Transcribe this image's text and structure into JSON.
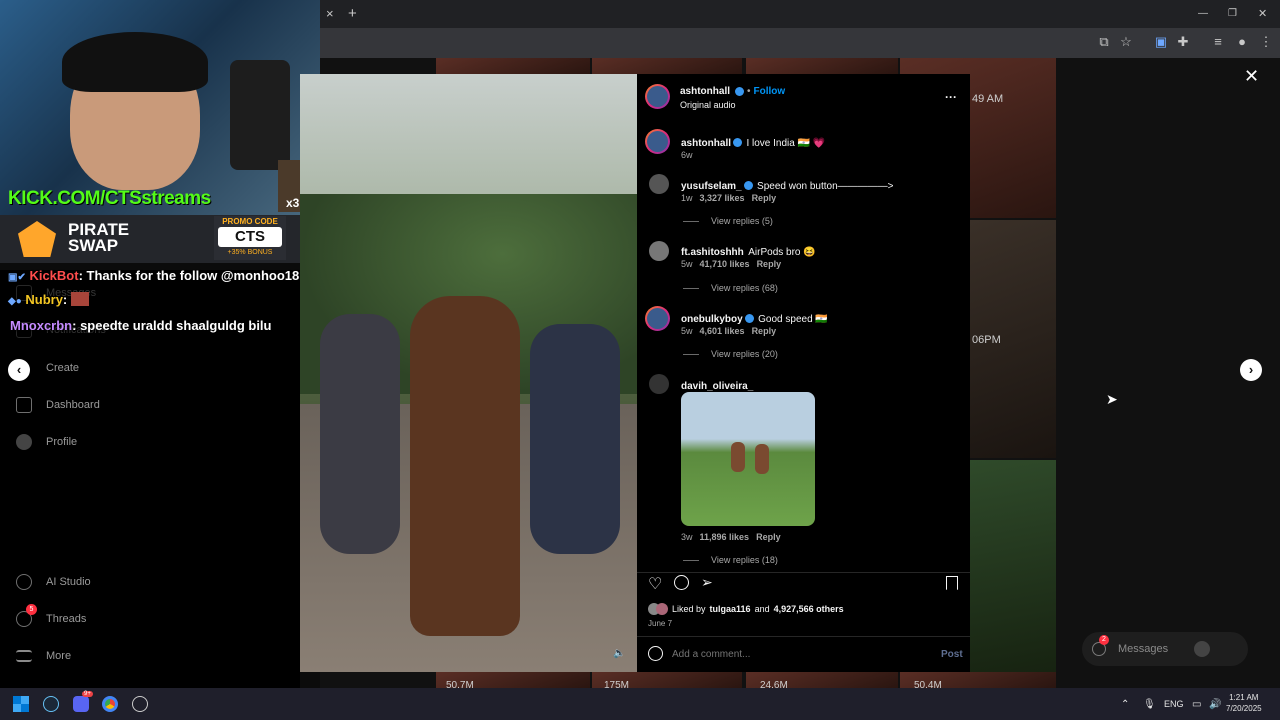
{
  "browser": {
    "close_tab": "×",
    "new_tab": "+",
    "minimize": "—",
    "restore": "❐",
    "close_window": "✕"
  },
  "sidebar": {
    "items": [
      {
        "label": "Messages",
        "icon": "paper-plane-icon"
      },
      {
        "label": "Notifications",
        "icon": "heart-icon"
      },
      {
        "label": "Create",
        "icon": "plus-icon"
      },
      {
        "label": "Dashboard",
        "icon": "chart-icon"
      },
      {
        "label": "Profile",
        "icon": "profile-icon"
      },
      {
        "label": "AI Studio",
        "icon": "ai-studio-icon"
      },
      {
        "label": "Threads",
        "icon": "threads-icon",
        "badge": "5"
      },
      {
        "label": "More",
        "icon": "menu-icon"
      }
    ]
  },
  "grid": {
    "time_1": "49 AM",
    "time_2": "06PM",
    "views": [
      "50.7M",
      "175M",
      "24.6M",
      "50.4M"
    ]
  },
  "stream": {
    "kick": "KICK.COM/CTSstreams",
    "badge": "x3",
    "pirate_swap": "PIRATE SWAP",
    "promo_label": "PROMO CODE",
    "promo_code": "CTS",
    "promo_bonus": "+35% BONUS",
    "chat": [
      {
        "user": "KickBot",
        "user_color": "#ff4d4d",
        "text": ": Thanks for the follow @monhoo18"
      },
      {
        "user": "Nubry",
        "user_color": "#f3c623",
        "text": ":"
      },
      {
        "user": "Mnoxcrbn",
        "user_color": "#c58bff",
        "text": ": speedte uraldd shaalguldg bilu"
      }
    ]
  },
  "post": {
    "author": "ashtonhall",
    "follow": "Follow",
    "audio": "Original audio",
    "more": "···",
    "caption_user": "ashtonhall",
    "caption_text": "I love India 🇮🇳 💗",
    "caption_age": "6w",
    "comments": [
      {
        "user": "yusufselam_",
        "text": "Speed won button—————>",
        "age": "1w",
        "likes": "3,327 likes",
        "reply": "Reply",
        "view_replies": "View replies (5)"
      },
      {
        "user": "ft.ashitoshhh",
        "text": "AirPods bro 😆",
        "age": "5w",
        "likes": "41,710 likes",
        "reply": "Reply",
        "view_replies": "View replies (68)"
      },
      {
        "user": "onebulkyboy",
        "text": "Good speed 🇮🇳",
        "age": "5w",
        "likes": "4,601 likes",
        "reply": "Reply",
        "view_replies": "View replies (20)"
      },
      {
        "user": "davih_oliveira_",
        "text": "",
        "age": "3w",
        "likes": "11,896 likes",
        "reply": "Reply",
        "view_replies": "View replies (18)"
      }
    ],
    "liked_by_prefix": "Liked by",
    "liked_by_user": "tulgaa116",
    "liked_by_and": "and",
    "liked_by_others": "4,927,566 others",
    "date": "June 7",
    "add_comment_placeholder": "Add a comment...",
    "post_button": "Post"
  },
  "messages_pill": "Messages",
  "messages_badge": "2",
  "taskbar": {
    "lang": "ENG",
    "time": "1:21 AM",
    "date": "7/20/2025",
    "discord_badge": "9+"
  },
  "colors": {
    "kick_green": "#53fc18",
    "ig_blue": "#0095f6",
    "verified": "#3897f0"
  }
}
